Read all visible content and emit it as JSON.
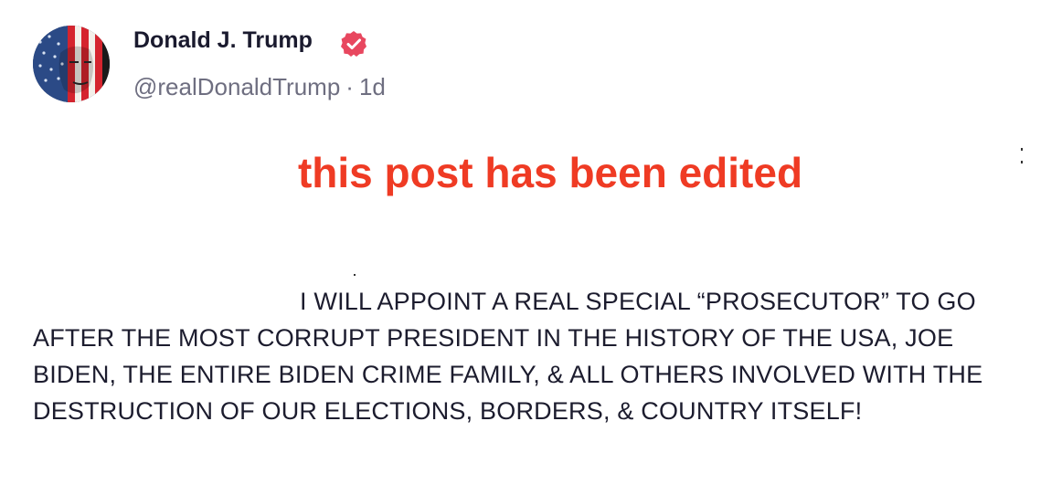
{
  "author": {
    "display_name": "Donald J. Trump",
    "verified": true,
    "verified_icon": "verified-badge-icon",
    "handle": "@realDonaldTrump",
    "separator": "·",
    "timestamp": "1d"
  },
  "banner": {
    "text": "this post has been edited"
  },
  "post": {
    "text": "I WILL APPOINT A REAL SPECIAL “PROSECUTOR” TO GO AFTER THE MOST CORRUPT PRESIDENT IN THE HISTORY OF THE USA, JOE BIDEN, THE ENTIRE BIDEN CRIME FAMILY, & ALL OTHERS INVOLVED WITH THE DESTRUCTION OF OUR ELECTIONS, BORDERS, & COUNTRY ITSELF!"
  },
  "colors": {
    "banner": "#ef3b24",
    "verified": "#e8475f",
    "meta": "#6e6e80",
    "text": "#1c1c2e"
  }
}
